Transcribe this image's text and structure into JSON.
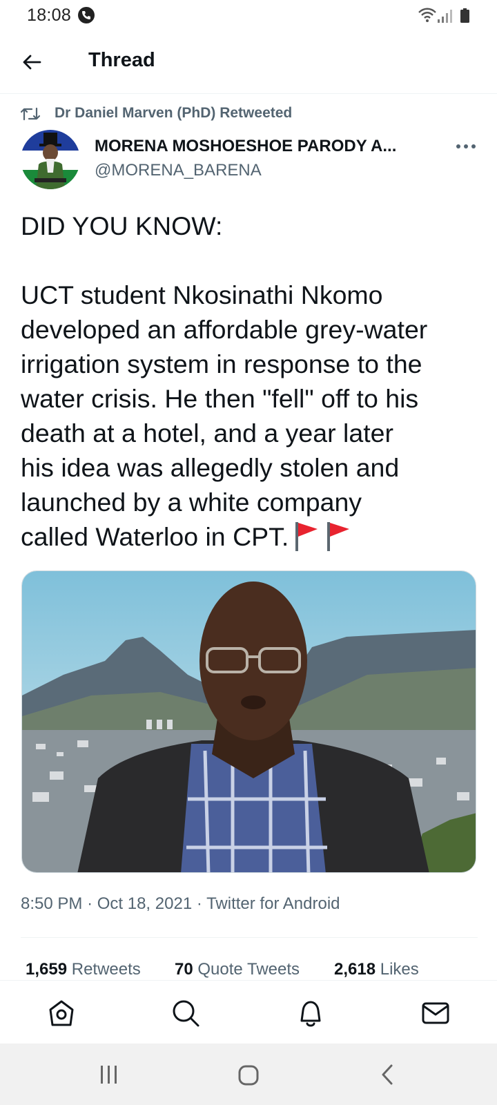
{
  "status_bar": {
    "time": "18:08",
    "icons": [
      "phone-call-icon",
      "wifi-icon",
      "signal-icon",
      "battery-icon"
    ]
  },
  "header": {
    "title": "Thread",
    "back_icon": "back-arrow-icon"
  },
  "retweet": {
    "label": "Dr Daniel Marven (PhD) Retweeted",
    "icon": "retweet-icon"
  },
  "author": {
    "name": "MORENA MOSHOESHOE PARODY A...",
    "handle": "@MORENA_BARENA",
    "more_icon": "more-options-icon"
  },
  "tweet": {
    "lines": [
      "DID YOU KNOW:",
      "",
      "UCT student Nkosinathi Nkomo",
      "developed an affordable grey-water",
      "irrigation system in response to the",
      "water crisis. He then \"fell\" off to his",
      "death at a hotel, and a year later",
      "his idea was allegedly stolen and",
      "launched by a white company",
      "called Waterloo in CPT."
    ],
    "emoji": [
      "red-flag-icon",
      "red-flag-icon"
    ]
  },
  "meta": {
    "time": "8:50 PM",
    "date": "Oct 18, 2021",
    "client": "Twitter for Android",
    "separator": "·"
  },
  "stats": {
    "retweets_count": "1,659",
    "retweets_label": "Retweets",
    "quotes_count": "70",
    "quotes_label": "Quote Tweets",
    "likes_count": "2,618",
    "likes_label": "Likes"
  },
  "tabbar": {
    "items": [
      "home-icon",
      "search-icon",
      "notifications-icon",
      "messages-icon"
    ]
  },
  "navbar": {
    "items": [
      "recent-apps-icon",
      "home-button-icon",
      "back-button-icon"
    ]
  },
  "colors": {
    "text_primary": "#0f1419",
    "text_secondary": "#536471",
    "divider": "#eff3f4",
    "flag_red": "#e8232f"
  }
}
